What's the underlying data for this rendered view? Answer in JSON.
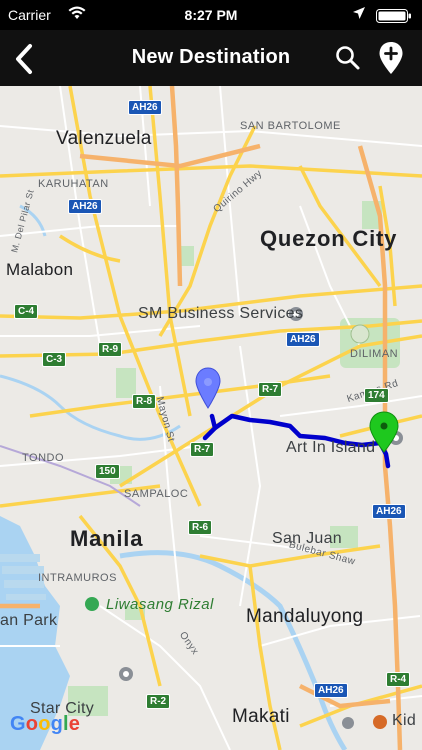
{
  "status_bar": {
    "carrier": "Carrier",
    "time": "8:27 PM"
  },
  "nav": {
    "title": "New Destination"
  },
  "icons": {
    "back": "chevron-left-icon",
    "search": "search-icon",
    "add_location": "add-location-pin-icon",
    "wifi": "wifi-icon",
    "location_arrow": "location-arrow-icon",
    "battery": "battery-icon"
  },
  "colors": {
    "route": "#0000cc",
    "start_pin": "#6b7cff",
    "end_pin": "#1ec81e"
  },
  "map": {
    "labels": {
      "valenzuela": "Valenzuela",
      "quezon_city": "Quezon City",
      "malabon": "Malabon",
      "sm_business": "SM Business Services",
      "diliman": "DILIMAN",
      "kamias_rd": "Kamias Rd",
      "art_in_island": "Art In Island",
      "tondo": "TONDO",
      "sampaloc": "SAMPALOC",
      "manila": "Manila",
      "san_juan": "San Juan",
      "bulebar_shaw": "Bulebar Shaw",
      "intramuros": "INTRAMUROS",
      "liwasang_rizal": "Liwasang Rizal",
      "an_park": "an Park",
      "mandaluyong": "Mandaluyong",
      "onyx": "Onyx",
      "star_city": "Star City",
      "makati": "Makati",
      "kid": "Kid",
      "san_bartolome": "SAN BARTOLOME",
      "karuhatan": "KARUHATAN",
      "quirino_hwy": "Quirino Hwy",
      "del_pilar": "M. Del Pilar St",
      "mayon_st": "Mayon St",
      "google": "Google"
    },
    "shields": {
      "ah26_top": "AH26",
      "ah26_left": "AH26",
      "ah26_mid": "AH26",
      "ah26_right": "AH26",
      "ah26_bottom": "AH26",
      "c4": "C-4",
      "c3": "C-3",
      "r9": "R-9",
      "r8": "R-8",
      "r7a": "R-7",
      "r7b": "R-7",
      "n174": "174",
      "n150": "150",
      "r6": "R-6",
      "r4": "R-4",
      "r2": "R-2"
    }
  }
}
